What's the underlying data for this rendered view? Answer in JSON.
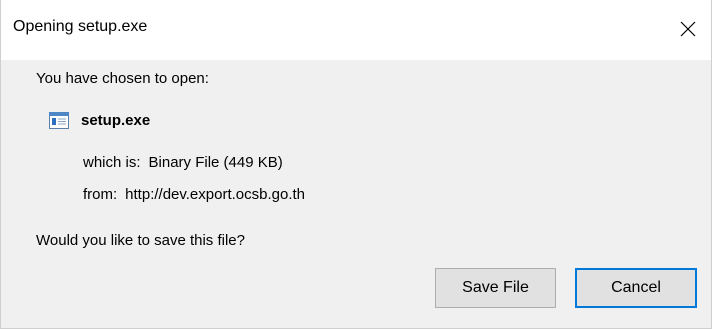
{
  "window": {
    "title": "Opening setup.exe"
  },
  "dialog": {
    "intro": "You have chosen to open:",
    "file_icon": "executable-file-icon",
    "file_name": "setup.exe",
    "which_label": "which is:",
    "which_value": "Binary File (449 KB)",
    "from_label": "from:",
    "from_value": "http://dev.export.ocsb.go.th",
    "question": "Would you like to save this file?"
  },
  "buttons": {
    "save_label": "Save File",
    "cancel_label": "Cancel"
  },
  "colors": {
    "dialog_background": "#f0f0f0",
    "titlebar_background": "#ffffff",
    "button_background": "#e1e1e1",
    "default_button_border": "#0078d7"
  },
  "icons": {
    "close": "close-icon"
  }
}
